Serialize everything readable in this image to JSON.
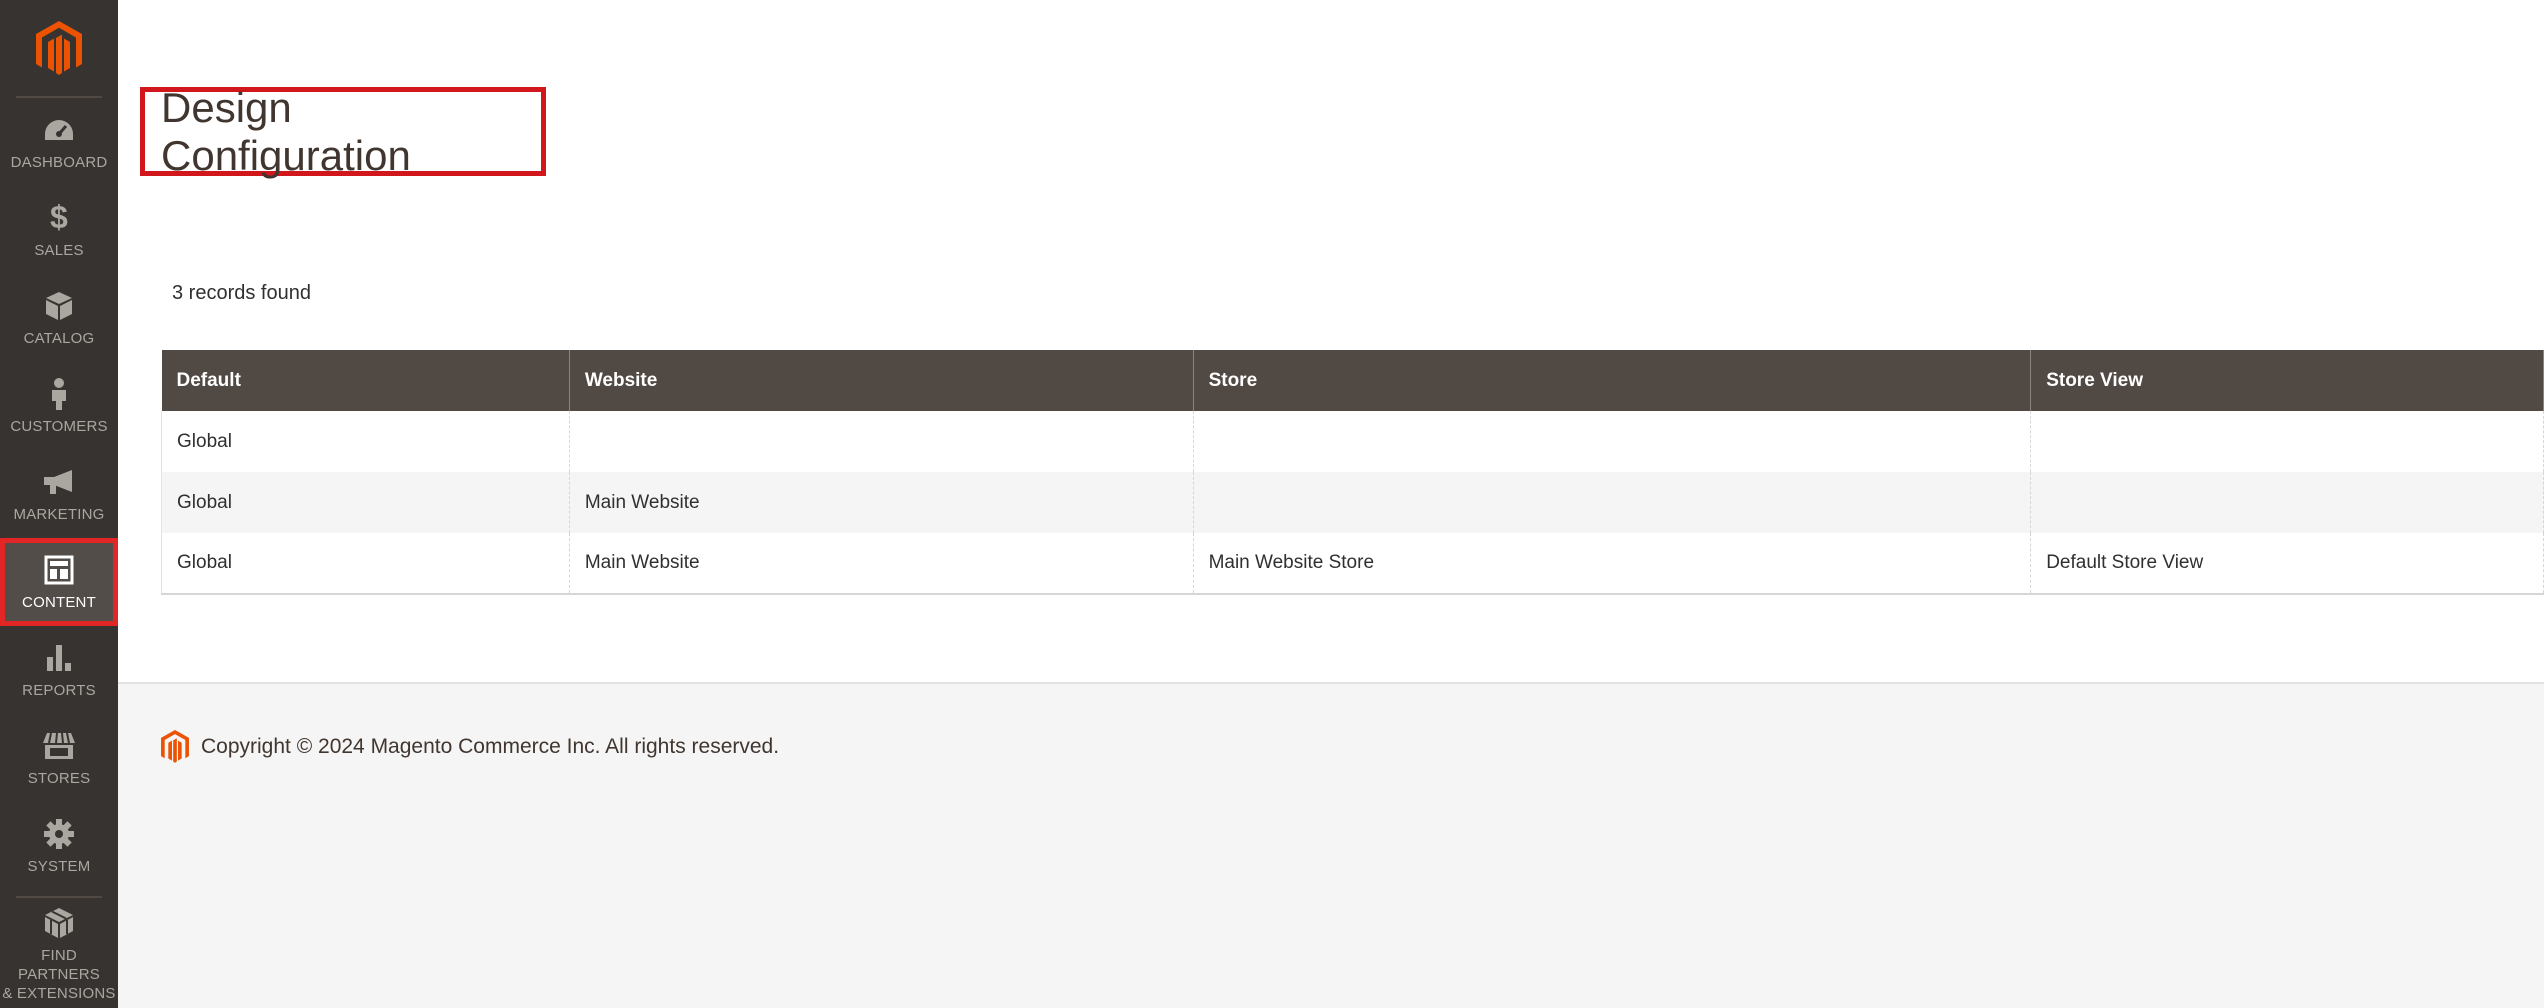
{
  "sidebar": {
    "logo": "magento-logo",
    "items": [
      {
        "label": "DASHBOARD",
        "icon": "dashboard-icon"
      },
      {
        "label": "SALES",
        "icon": "dollar-icon"
      },
      {
        "label": "CATALOG",
        "icon": "box-icon"
      },
      {
        "label": "CUSTOMERS",
        "icon": "person-icon"
      },
      {
        "label": "MARKETING",
        "icon": "megaphone-icon"
      },
      {
        "label": "CONTENT",
        "icon": "layout-icon",
        "active": true
      },
      {
        "label": "REPORTS",
        "icon": "bar-chart-icon"
      },
      {
        "label": "STORES",
        "icon": "store-icon"
      },
      {
        "label": "SYSTEM",
        "icon": "gear-icon"
      },
      {
        "label": "FIND PARTNERS & EXTENSIONS",
        "line1": "FIND PARTNERS",
        "line2": "& EXTENSIONS",
        "icon": "cubes-icon"
      }
    ]
  },
  "page": {
    "title": "Design Configuration",
    "records_found": "3 records found"
  },
  "grid": {
    "columns": [
      "Default",
      "Website",
      "Store",
      "Store View"
    ],
    "rows": [
      [
        "Global",
        "",
        "",
        ""
      ],
      [
        "Global",
        "Main Website",
        "",
        ""
      ],
      [
        "Global",
        "Main Website",
        "Main Website Store",
        "Default Store View"
      ]
    ]
  },
  "footer": {
    "copyright": "Copyright © 2024 Magento Commerce Inc. All rights reserved."
  },
  "colors": {
    "sidebar_bg": "#373330",
    "accent": "#eb5202",
    "highlight": "#d1161c",
    "header_bg": "#514943"
  }
}
